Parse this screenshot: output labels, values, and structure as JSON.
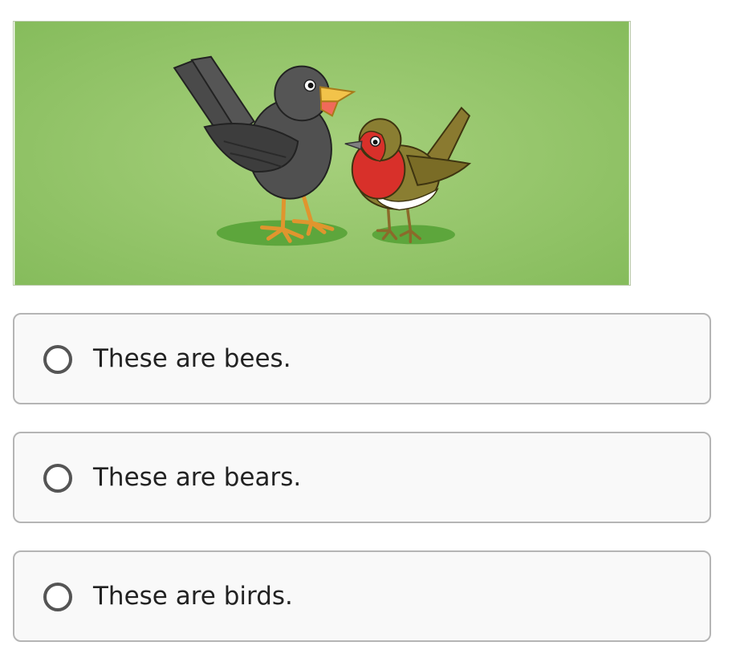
{
  "illustration": {
    "icon": "two-birds-illustration",
    "background_color": "#8fc064"
  },
  "question": {
    "choices": [
      {
        "label": "These are bees."
      },
      {
        "label": "These are bears."
      },
      {
        "label": "These are birds."
      }
    ]
  }
}
